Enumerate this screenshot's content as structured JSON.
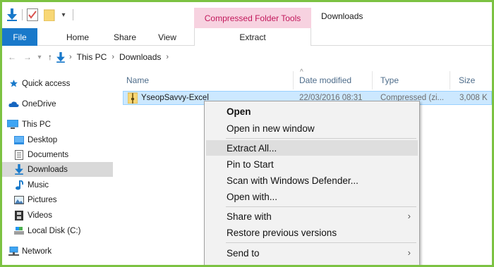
{
  "window": {
    "title": "Downloads",
    "contextual_group": "Compressed Folder Tools"
  },
  "ribbon": {
    "tabs": [
      {
        "label": "File"
      },
      {
        "label": "Home"
      },
      {
        "label": "Share"
      },
      {
        "label": "View"
      },
      {
        "label": "Extract"
      }
    ]
  },
  "address": {
    "crumbs": [
      "This PC",
      "Downloads"
    ]
  },
  "sidebar": {
    "items": [
      {
        "label": "Quick access",
        "icon": "star-icon"
      },
      {
        "label": "OneDrive",
        "icon": "cloud-icon"
      },
      {
        "label": "This PC",
        "icon": "computer-icon"
      },
      {
        "label": "Desktop",
        "icon": "desktop-folder-icon"
      },
      {
        "label": "Documents",
        "icon": "documents-icon"
      },
      {
        "label": "Downloads",
        "icon": "download-arrow-icon"
      },
      {
        "label": "Music",
        "icon": "music-note-icon"
      },
      {
        "label": "Pictures",
        "icon": "pictures-icon"
      },
      {
        "label": "Videos",
        "icon": "film-icon"
      },
      {
        "label": "Local Disk (C:)",
        "icon": "drive-icon"
      },
      {
        "label": "Network",
        "icon": "network-icon"
      }
    ]
  },
  "columns": {
    "name": "Name",
    "date": "Date modified",
    "type": "Type",
    "size": "Size"
  },
  "files": [
    {
      "name": "YseopSavvy-Excel",
      "date": "22/03/2016 08:31",
      "type": "Compressed (zi...",
      "size": "3,008 K"
    }
  ],
  "context_menu": {
    "items": [
      {
        "label": "Open"
      },
      {
        "label": "Open in new window"
      },
      {
        "label": "Extract All..."
      },
      {
        "label": "Pin to Start"
      },
      {
        "label": "Scan with Windows Defender..."
      },
      {
        "label": "Open with..."
      },
      {
        "label": "Share with"
      },
      {
        "label": "Restore previous versions"
      },
      {
        "label": "Send to"
      }
    ]
  },
  "colors": {
    "accent_blue": "#1979ca",
    "contextual_pink": "#f7d2e0",
    "selection": "#cce8ff",
    "frame_green": "#7cc242"
  }
}
